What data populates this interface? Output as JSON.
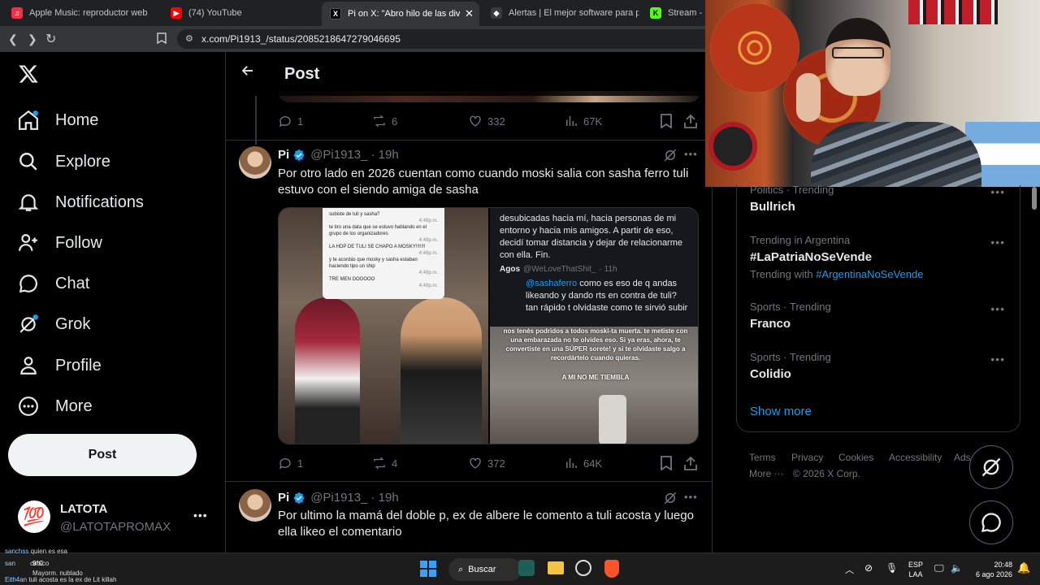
{
  "browser": {
    "tabs": [
      {
        "label": "Apple Music: reproductor web",
        "color": "#fa2d48",
        "glyph": "♫"
      },
      {
        "label": "(74) YouTube",
        "color": "#ff0000",
        "glyph": "▶"
      },
      {
        "label": "Pi on X: \"Abro hilo de las diversa",
        "color": "#000000",
        "glyph": "X"
      },
      {
        "label": "Alertas | El mejor software para poter",
        "color": "#3a3a3a",
        "glyph": "◆"
      },
      {
        "label": "Stream - Kic",
        "color": "#53fc18",
        "glyph": "K"
      }
    ],
    "url": "x.com/Pi1913_/status/2085218647279046695"
  },
  "sidebar": {
    "items": [
      {
        "label": "Home"
      },
      {
        "label": "Explore"
      },
      {
        "label": "Notifications"
      },
      {
        "label": "Follow"
      },
      {
        "label": "Chat"
      },
      {
        "label": "Grok"
      },
      {
        "label": "Profile"
      },
      {
        "label": "More"
      }
    ],
    "post_label": "Post",
    "account": {
      "name": "LATOTA",
      "handle": "@LATOTAPROMAX",
      "avatar_glyph": "💯"
    }
  },
  "main": {
    "title": "Post",
    "top_stats": {
      "replies": "1",
      "reposts": "6",
      "likes": "332",
      "views": "67K"
    },
    "posts": [
      {
        "name": "Pi",
        "handle": "@Pi1913_",
        "time": "· 19h",
        "text": "Por otro lado en 2026 cuentan como cuando moski salia con sasha ferro tuli estuvo con el siendo amiga de sasha",
        "stats": {
          "replies": "1",
          "reposts": "4",
          "likes": "372",
          "views": "64K"
        },
        "media": {
          "left_chat": [
            {
              "text": "subiste de tuli y sasha?",
              "time": "4:48p.m."
            },
            {
              "text": "te tiro una data que se estuvo hablando en el grupo de los organizadores",
              "time": "4:48p.m."
            },
            {
              "text": "LA HDP DE TULI SE CHAPO A MOSKY!!!!!!!",
              "time": "4:48p.m."
            },
            {
              "text": "y te acordás que mosky y sasha estaban haciendo tipo un ship",
              "time": "4:48p.m."
            },
            {
              "text": "TRE MEN DOOOOO",
              "time": "4:48p.m."
            }
          ],
          "right_top_text": "desubicadas hacia mí, hacia personas de mi entorno y hacia mis amigos. A partir de eso, decidí tomar distancia y dejar de relacionarme con ella. Fin.",
          "quote_name": "Agos",
          "quote_handle": "@WeLoveThatShit_",
          "quote_time": "· 11h",
          "quote_mention": "@sashaferro",
          "quote_text": "como es eso de q andas likeando y dando rts en contra de tuli? tan rápido t olvidaste como te sirvió subir",
          "overlay_text": "nos tenés podridos a todos moski-ta muerta. te metiste con una embarazada no te olvides eso. Si ya eras, ahora, te convertiste en una SÚPER sorete! y si te olvidaste salgo a recordártelo cuando quieras.",
          "overlay_final": "A MI NO ME TIEMBLA"
        }
      },
      {
        "name": "Pi",
        "handle": "@Pi1913_",
        "time": "· 19h",
        "text": "Por ultimo la mamá del doble p, ex de albere le comento a tuli acosta y luego ella likeo el comentario"
      }
    ]
  },
  "trends": [
    {
      "meta": "Politics · Trending",
      "name": "Bullrich"
    },
    {
      "meta": "Trending in Argentina",
      "name": "#LaPatriaNoSeVende",
      "with_label": "Trending with",
      "with_tag": "#ArgentinaNoSeVende"
    },
    {
      "meta": "Sports · Trending",
      "name": "Franco"
    },
    {
      "meta": "Sports · Trending",
      "name": "Colidio"
    }
  ],
  "show_more": "Show more",
  "footer": {
    "links": [
      "Terms",
      "Privacy",
      "Cookies",
      "Accessibility",
      "Ads",
      "More ···"
    ],
    "copyright": "© 2026 X Corp."
  },
  "overlay_chat": [
    {
      "user": "sanchss",
      "msg": "quien es esa"
    },
    {
      "user": "san",
      "msg": "cubico"
    },
    {
      "user": "",
      "msg": "Mayorm. nublado"
    },
    {
      "user": "Eith4an",
      "msg": "tuli acosta es la ex de Lit killah"
    }
  ],
  "taskbar": {
    "weather_temp": "9°C",
    "search_label": "Buscar",
    "lang_top": "ESP",
    "lang_bottom": "LAA",
    "time": "20:48",
    "date": "6 ago 2026"
  },
  "colors": {
    "accent": "#1d9bf0",
    "verified": "#1d9bf0",
    "bg": "#000000",
    "border": "#2f3336",
    "muted": "#71767b"
  }
}
